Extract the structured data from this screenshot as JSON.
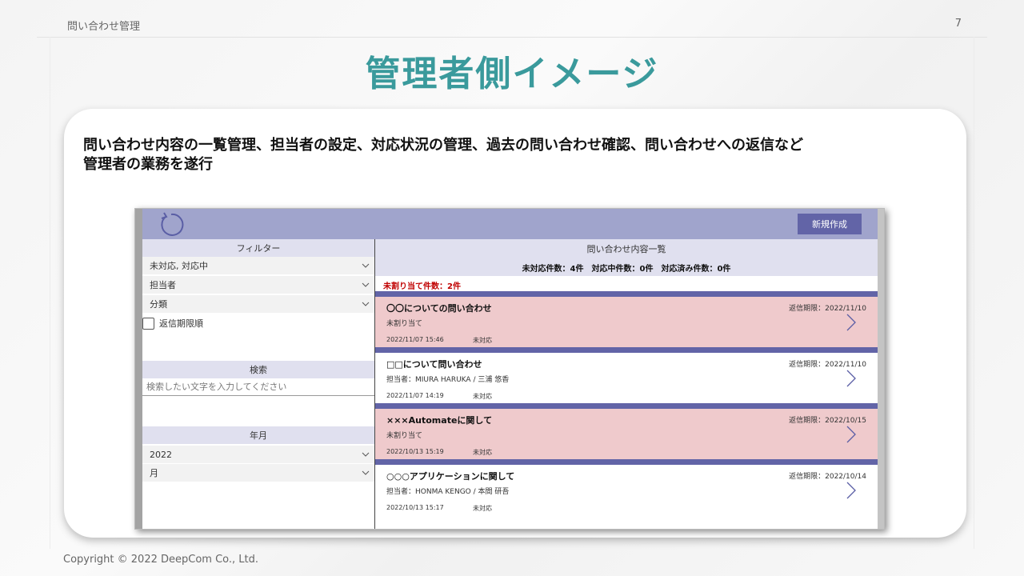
{
  "slide": {
    "header": "問い合わせ管理",
    "page_number": "7",
    "title": "管理者側イメージ",
    "description_line1": "問い合わせ内容の一覧管理、担当者の設定、対応状況の管理、過去の問い合わせ確認、問い合わせへの返信など",
    "description_line2": "管理者の業務を遂行",
    "footer": "Copyright © 2022 DeepCom Co., Ltd."
  },
  "app": {
    "new_button": "新規作成",
    "refresh_icon": "refresh-icon",
    "filter": {
      "title": "フィルター",
      "status_value": "未対応, 対応中",
      "assignee_value": "担当者",
      "category_value": "分類",
      "checkbox_label": "返信期限順"
    },
    "search": {
      "title": "検索",
      "placeholder": "検索したい文字を入力してください"
    },
    "year_month": {
      "title": "年月",
      "year_value": "2022",
      "month_value": "月"
    },
    "list": {
      "title": "問い合わせ内容一覧",
      "counts": "未対応件数：4件　対応中件数：0件　対応済み件数：0件",
      "unassigned_count": "未割り当て件数：2件",
      "items": [
        {
          "title": "〇〇についての問い合わせ",
          "deadline": "返信期限：2022/11/10",
          "sub": "未割り当て",
          "date": "2022/11/07 15:46",
          "status": "未対応",
          "highlight": true
        },
        {
          "title": "□□について問い合わせ",
          "deadline": "返信期限：2022/11/10",
          "sub": "担当者：MIURA HARUKA / 三浦 悠香",
          "date": "2022/11/07 14:19",
          "status": "未対応",
          "highlight": false
        },
        {
          "title": "×××Automateに関して",
          "deadline": "返信期限：2022/10/15",
          "sub": "未割り当て",
          "date": "2022/10/13 15:19",
          "status": "未対応",
          "highlight": true
        },
        {
          "title": "○○○アプリケーションに関して",
          "deadline": "返信期限：2022/10/14",
          "sub": "担当者：HONMA KENGO / 本間 研吾",
          "date": "2022/10/13 15:17",
          "status": "未対応",
          "highlight": false
        }
      ]
    }
  },
  "colors": {
    "title_teal": "#3a9a9c",
    "header_bar": "#a0a4cc",
    "accent": "#6264a7",
    "highlight_row": "#efcacc",
    "unassigned_red": "#c00000"
  }
}
